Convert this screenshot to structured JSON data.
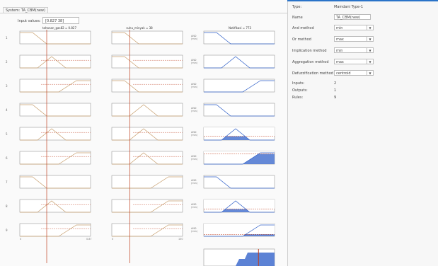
{
  "system_tab": "System: TA_CBM(new)",
  "input_values_label": "Input values:",
  "input_values": "[0.827 38]",
  "columns": [
    {
      "title": "tahanan_gas82 = 0.827",
      "axis_min": "0",
      "axis_max": "0.87"
    },
    {
      "title": "suhu_minyak = 38",
      "axis_min": "0",
      "axis_max": "150"
    },
    {
      "title": "Notifikasi = 773",
      "axis_min": "0",
      "axis_max": "1000"
    }
  ],
  "rule_numbers": [
    "1",
    "2",
    "3",
    "4",
    "5",
    "6",
    "7",
    "8",
    "9"
  ],
  "rule_op": "AND",
  "rule_prob": "(min)",
  "inputs_crosshair": [
    0.827,
    38
  ],
  "output_value": 773,
  "properties": {
    "type_label": "Type:",
    "type_value": "Mamdani Type-1",
    "name_label": "Name",
    "name_value": "TA_CBM(new)",
    "and_label": "And method",
    "and_value": "min",
    "or_label": "Or method",
    "or_value": "max",
    "impl_label": "Implication method",
    "impl_value": "min",
    "agg_label": "Aggregation method",
    "agg_value": "max",
    "defuzz_label": "Defuzzification method",
    "defuzz_value": "centroid",
    "inputs_label": "Inputs:",
    "inputs_value": "2",
    "outputs_label": "Outputs:",
    "outputs_value": "1",
    "rules_label": "Rules:",
    "rules_value": "9"
  },
  "colors": {
    "input_mf": "#c8a070",
    "output_mf": "#3060c8",
    "fill": "#4a74d0",
    "crosshair": "#c04020",
    "outline": "#999999"
  },
  "dropdown_icon": "chevron-down-icon"
}
